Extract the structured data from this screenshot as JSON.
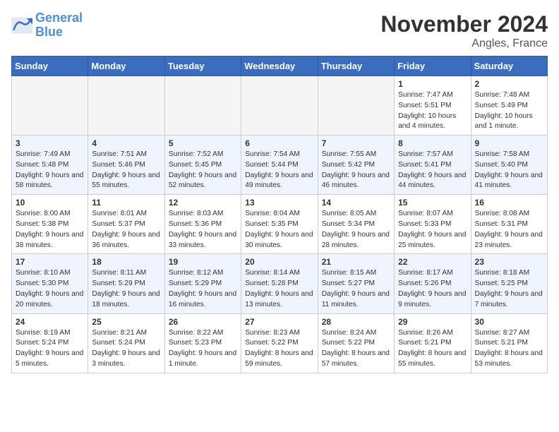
{
  "logo": {
    "line1": "General",
    "line2": "Blue"
  },
  "title": "November 2024",
  "location": "Angles, France",
  "weekdays": [
    "Sunday",
    "Monday",
    "Tuesday",
    "Wednesday",
    "Thursday",
    "Friday",
    "Saturday"
  ],
  "weeks": [
    [
      {
        "day": "",
        "empty": true
      },
      {
        "day": "",
        "empty": true
      },
      {
        "day": "",
        "empty": true
      },
      {
        "day": "",
        "empty": true
      },
      {
        "day": "",
        "empty": true
      },
      {
        "day": "1",
        "sunrise": "7:47 AM",
        "sunset": "5:51 PM",
        "daylight": "10 hours and 4 minutes."
      },
      {
        "day": "2",
        "sunrise": "7:48 AM",
        "sunset": "5:49 PM",
        "daylight": "10 hours and 1 minute."
      }
    ],
    [
      {
        "day": "3",
        "sunrise": "7:49 AM",
        "sunset": "5:48 PM",
        "daylight": "9 hours and 58 minutes."
      },
      {
        "day": "4",
        "sunrise": "7:51 AM",
        "sunset": "5:46 PM",
        "daylight": "9 hours and 55 minutes."
      },
      {
        "day": "5",
        "sunrise": "7:52 AM",
        "sunset": "5:45 PM",
        "daylight": "9 hours and 52 minutes."
      },
      {
        "day": "6",
        "sunrise": "7:54 AM",
        "sunset": "5:44 PM",
        "daylight": "9 hours and 49 minutes."
      },
      {
        "day": "7",
        "sunrise": "7:55 AM",
        "sunset": "5:42 PM",
        "daylight": "9 hours and 46 minutes."
      },
      {
        "day": "8",
        "sunrise": "7:57 AM",
        "sunset": "5:41 PM",
        "daylight": "9 hours and 44 minutes."
      },
      {
        "day": "9",
        "sunrise": "7:58 AM",
        "sunset": "5:40 PM",
        "daylight": "9 hours and 41 minutes."
      }
    ],
    [
      {
        "day": "10",
        "sunrise": "8:00 AM",
        "sunset": "5:38 PM",
        "daylight": "9 hours and 38 minutes."
      },
      {
        "day": "11",
        "sunrise": "8:01 AM",
        "sunset": "5:37 PM",
        "daylight": "9 hours and 36 minutes."
      },
      {
        "day": "12",
        "sunrise": "8:03 AM",
        "sunset": "5:36 PM",
        "daylight": "9 hours and 33 minutes."
      },
      {
        "day": "13",
        "sunrise": "8:04 AM",
        "sunset": "5:35 PM",
        "daylight": "9 hours and 30 minutes."
      },
      {
        "day": "14",
        "sunrise": "8:05 AM",
        "sunset": "5:34 PM",
        "daylight": "9 hours and 28 minutes."
      },
      {
        "day": "15",
        "sunrise": "8:07 AM",
        "sunset": "5:33 PM",
        "daylight": "9 hours and 25 minutes."
      },
      {
        "day": "16",
        "sunrise": "8:08 AM",
        "sunset": "5:31 PM",
        "daylight": "9 hours and 23 minutes."
      }
    ],
    [
      {
        "day": "17",
        "sunrise": "8:10 AM",
        "sunset": "5:30 PM",
        "daylight": "9 hours and 20 minutes."
      },
      {
        "day": "18",
        "sunrise": "8:11 AM",
        "sunset": "5:29 PM",
        "daylight": "9 hours and 18 minutes."
      },
      {
        "day": "19",
        "sunrise": "8:12 AM",
        "sunset": "5:29 PM",
        "daylight": "9 hours and 16 minutes."
      },
      {
        "day": "20",
        "sunrise": "8:14 AM",
        "sunset": "5:28 PM",
        "daylight": "9 hours and 13 minutes."
      },
      {
        "day": "21",
        "sunrise": "8:15 AM",
        "sunset": "5:27 PM",
        "daylight": "9 hours and 11 minutes."
      },
      {
        "day": "22",
        "sunrise": "8:17 AM",
        "sunset": "5:26 PM",
        "daylight": "9 hours and 9 minutes."
      },
      {
        "day": "23",
        "sunrise": "8:18 AM",
        "sunset": "5:25 PM",
        "daylight": "9 hours and 7 minutes."
      }
    ],
    [
      {
        "day": "24",
        "sunrise": "8:19 AM",
        "sunset": "5:24 PM",
        "daylight": "9 hours and 5 minutes."
      },
      {
        "day": "25",
        "sunrise": "8:21 AM",
        "sunset": "5:24 PM",
        "daylight": "9 hours and 3 minutes."
      },
      {
        "day": "26",
        "sunrise": "8:22 AM",
        "sunset": "5:23 PM",
        "daylight": "9 hours and 1 minute."
      },
      {
        "day": "27",
        "sunrise": "8:23 AM",
        "sunset": "5:22 PM",
        "daylight": "8 hours and 59 minutes."
      },
      {
        "day": "28",
        "sunrise": "8:24 AM",
        "sunset": "5:22 PM",
        "daylight": "8 hours and 57 minutes."
      },
      {
        "day": "29",
        "sunrise": "8:26 AM",
        "sunset": "5:21 PM",
        "daylight": "8 hours and 55 minutes."
      },
      {
        "day": "30",
        "sunrise": "8:27 AM",
        "sunset": "5:21 PM",
        "daylight": "8 hours and 53 minutes."
      }
    ]
  ]
}
